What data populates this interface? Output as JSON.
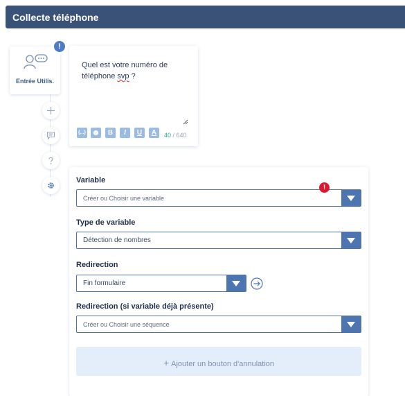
{
  "header": {
    "title": "Collecte téléphone"
  },
  "entree": {
    "label": "Entrée Utilis.",
    "badge": "!"
  },
  "message": {
    "text_before": "Quel est votre numéro de téléphone ",
    "text_misspelled": "svp",
    "text_after": " ?",
    "count": "40",
    "separator": " / ",
    "max": "640",
    "toolbar": {
      "variable_label": "{...}",
      "emoji_label": "☻",
      "bold_label": "B",
      "italic_label": "I",
      "underline_label": "U",
      "color_label": "A"
    }
  },
  "form": {
    "variable": {
      "label": "Variable",
      "placeholder": "Créer ou Choisir une variable",
      "error_badge": "!"
    },
    "variable_type": {
      "label": "Type de variable",
      "value": "Détection de nombres"
    },
    "redirection": {
      "label": "Redirection",
      "value": "Fin formulaire"
    },
    "redirection_present": {
      "label": "Redirection (si variable déjà présente)",
      "placeholder": "Créer ou Choisir une séquence"
    },
    "cancel_button": {
      "icon": "+",
      "label": "Ajouter un bouton d'annulation"
    }
  },
  "colors": {
    "header": "#3b5278",
    "accent": "#4d75b0",
    "error": "#e0182f",
    "counter": "#2fb38c"
  }
}
